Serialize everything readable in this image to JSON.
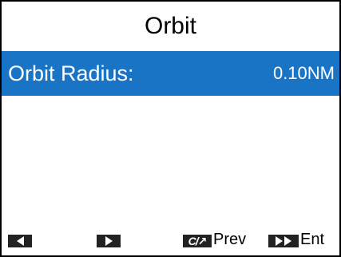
{
  "header": {
    "title": "Orbit"
  },
  "settings": [
    {
      "label": "Orbit Radius:",
      "value": "0.10NM"
    }
  ],
  "softkeys": {
    "left_icon": "left-arrow-icon",
    "right_icon": "right-arrow-icon",
    "prev_icon": "clear-adjust-icon",
    "prev_icon_text": "C/↗",
    "prev_label": "Prev",
    "enter_icon": "double-right-arrow-icon",
    "enter_label": "Ent"
  },
  "colors": {
    "highlight": "#1a74c6",
    "text": "#000000",
    "background": "#ffffff"
  }
}
